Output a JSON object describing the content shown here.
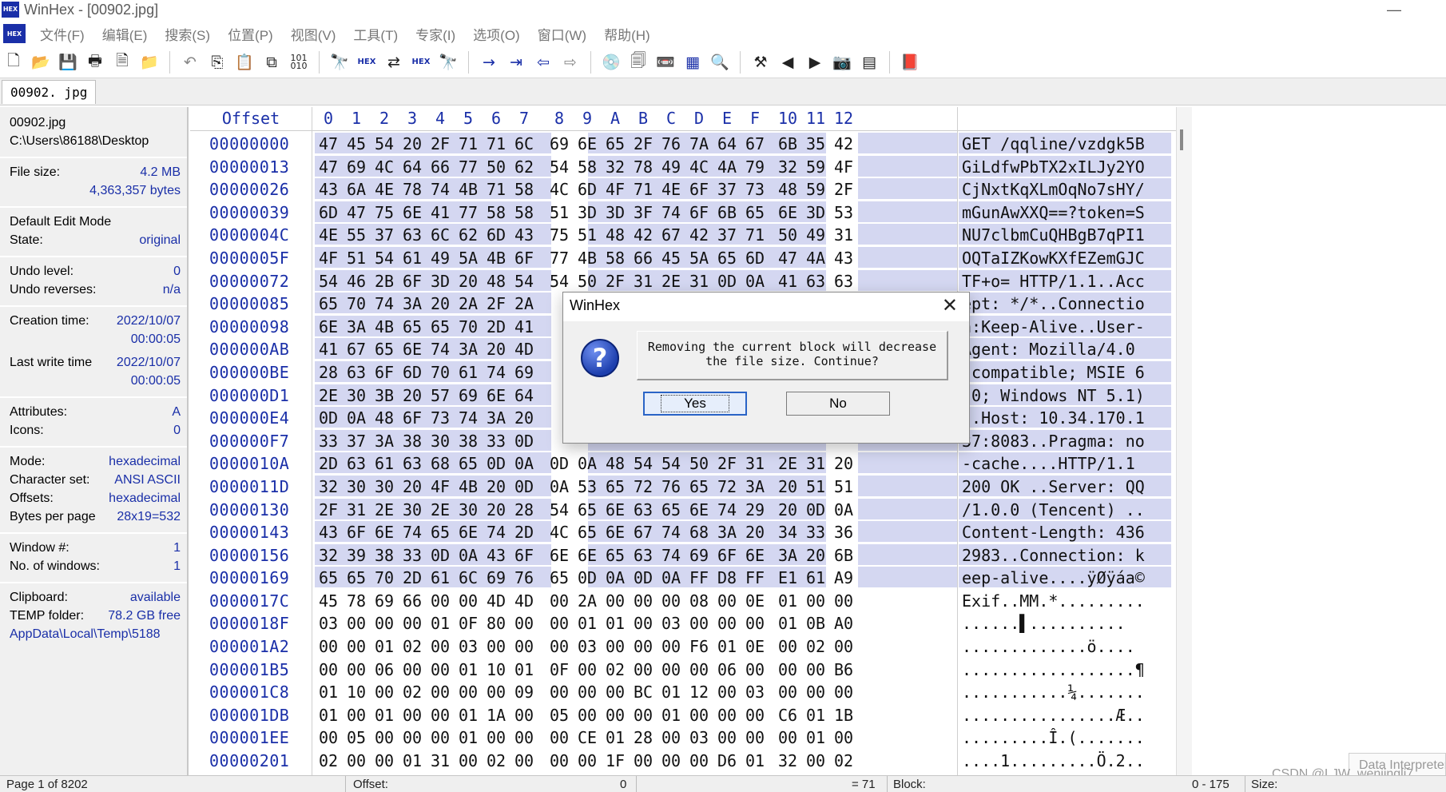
{
  "window": {
    "title": "WinHex - [00902.jpg]",
    "logo_text": "HEX",
    "minimize": "—"
  },
  "menu": [
    "文件(F)",
    "编辑(E)",
    "搜索(S)",
    "位置(P)",
    "视图(V)",
    "工具(T)",
    "专家(I)",
    "选项(O)",
    "窗口(W)",
    "帮助(H)"
  ],
  "toolbar": {
    "icons": [
      "new-file-icon",
      "open-folder-icon",
      "save-icon",
      "print-icon",
      "properties-icon",
      "open-folder-edit-icon",
      "undo-icon",
      "copy-icon",
      "paste-icon",
      "paste-special-icon",
      "binary-icon",
      "find-icon",
      "find-hex-icon",
      "replace-icon",
      "replace-hex-icon",
      "find-next-icon",
      "goto-offset-icon",
      "goto-sector-icon",
      "back-icon",
      "forward-icon",
      "disk-icon",
      "clone-icon",
      "tape-icon",
      "ram-icon",
      "search-icon",
      "tool-icon",
      "prev-icon",
      "next-icon",
      "camera-icon",
      "table-icon",
      "book-icon"
    ]
  },
  "tab": {
    "label": "00902. jpg"
  },
  "info": {
    "filename": "00902.jpg",
    "path": "C:\\Users\\86188\\Desktop",
    "file_size_label": "File size:",
    "file_size_mb": "4.2 MB",
    "file_size_bytes": "4,363,357 bytes",
    "edit_mode_label": "Default Edit Mode",
    "state_label": "State:",
    "state_value": "original",
    "undo_level_label": "Undo level:",
    "undo_level_value": "0",
    "undo_reverses_label": "Undo reverses:",
    "undo_reverses_value": "n/a",
    "creation_label": "Creation time:",
    "creation_date": "2022/10/07",
    "creation_time": "00:00:05",
    "lastwrite_label": "Last write time",
    "lastwrite_date": "2022/10/07",
    "lastwrite_time": "00:00:05",
    "attributes_label": "Attributes:",
    "attributes_value": "A",
    "icons_label": "Icons:",
    "icons_value": "0",
    "mode_label": "Mode:",
    "mode_value": "hexadecimal",
    "charset_label": "Character set:",
    "charset_value": "ANSI ASCII",
    "offsets_label": "Offsets:",
    "offsets_value": "hexadecimal",
    "bpp_label": "Bytes per page",
    "bpp_value": "28x19=532",
    "window_label": "Window #:",
    "window_value": "1",
    "nwindows_label": "No. of windows:",
    "nwindows_value": "1",
    "clipboard_label": "Clipboard:",
    "clipboard_value": "available",
    "temp_label": "TEMP folder:",
    "temp_value": "78.2 GB free",
    "temp_path": "5188\\AppData\\Local\\Temp"
  },
  "hex": {
    "offset_header": "Offset",
    "columns": [
      "0",
      "1",
      "2",
      "3",
      "4",
      "5",
      "6",
      "7",
      "8",
      "9",
      "A",
      "B",
      "C",
      "D",
      "E",
      "F",
      "10",
      "11",
      "12"
    ],
    "highlight_rows": 20,
    "rows": [
      {
        "offset": "00000000",
        "bytes": [
          "47",
          "45",
          "54",
          "20",
          "2F",
          "71",
          "71",
          "6C",
          "69",
          "6E",
          "65",
          "2F",
          "76",
          "7A",
          "64",
          "67",
          "6B",
          "35",
          "42"
        ],
        "ascii": "GET /qqline/vzdgk5B"
      },
      {
        "offset": "00000013",
        "bytes": [
          "47",
          "69",
          "4C",
          "64",
          "66",
          "77",
          "50",
          "62",
          "54",
          "58",
          "32",
          "78",
          "49",
          "4C",
          "4A",
          "79",
          "32",
          "59",
          "4F"
        ],
        "ascii": "GiLdfwPbTX2xILJy2YO"
      },
      {
        "offset": "00000026",
        "bytes": [
          "43",
          "6A",
          "4E",
          "78",
          "74",
          "4B",
          "71",
          "58",
          "4C",
          "6D",
          "4F",
          "71",
          "4E",
          "6F",
          "37",
          "73",
          "48",
          "59",
          "2F"
        ],
        "ascii": "CjNxtKqXLmOqNo7sHY/"
      },
      {
        "offset": "00000039",
        "bytes": [
          "6D",
          "47",
          "75",
          "6E",
          "41",
          "77",
          "58",
          "58",
          "51",
          "3D",
          "3D",
          "3F",
          "74",
          "6F",
          "6B",
          "65",
          "6E",
          "3D",
          "53"
        ],
        "ascii": "mGunAwXXQ==?token=S"
      },
      {
        "offset": "0000004C",
        "bytes": [
          "4E",
          "55",
          "37",
          "63",
          "6C",
          "62",
          "6D",
          "43",
          "75",
          "51",
          "48",
          "42",
          "67",
          "42",
          "37",
          "71",
          "50",
          "49",
          "31"
        ],
        "ascii": "NU7clbmCuQHBgB7qPI1"
      },
      {
        "offset": "0000005F",
        "bytes": [
          "4F",
          "51",
          "54",
          "61",
          "49",
          "5A",
          "4B",
          "6F",
          "77",
          "4B",
          "58",
          "66",
          "45",
          "5A",
          "65",
          "6D",
          "47",
          "4A",
          "43"
        ],
        "ascii": "OQTaIZKowKXfEZemGJC"
      },
      {
        "offset": "00000072",
        "bytes": [
          "54",
          "46",
          "2B",
          "6F",
          "3D",
          "20",
          "48",
          "54",
          "54",
          "50",
          "2F",
          "31",
          "2E",
          "31",
          "0D",
          "0A",
          "41",
          "63",
          "63"
        ],
        "ascii": "TF+o= HTTP/1.1..Acc"
      },
      {
        "offset": "00000085",
        "bytes": [
          "65",
          "70",
          "74",
          "3A",
          "20",
          "2A",
          "2F",
          "2A",
          "",
          "",
          "",
          "",
          "",
          "",
          "",
          "",
          "",
          "",
          ""
        ],
        "ascii": "ept: */*..Connectio"
      },
      {
        "offset": "00000098",
        "bytes": [
          "6E",
          "3A",
          "4B",
          "65",
          "65",
          "70",
          "2D",
          "41",
          "",
          "",
          "",
          "",
          "",
          "",
          "",
          "",
          "",
          "",
          ""
        ],
        "ascii": "n:Keep-Alive..User-"
      },
      {
        "offset": "000000AB",
        "bytes": [
          "41",
          "67",
          "65",
          "6E",
          "74",
          "3A",
          "20",
          "4D",
          "",
          "",
          "",
          "",
          "",
          "",
          "",
          "",
          "",
          "",
          ""
        ],
        "ascii": "Agent: Mozilla/4.0"
      },
      {
        "offset": "000000BE",
        "bytes": [
          "28",
          "63",
          "6F",
          "6D",
          "70",
          "61",
          "74",
          "69",
          "",
          "",
          "",
          "",
          "",
          "",
          "",
          "",
          "",
          "",
          ""
        ],
        "ascii": "(compatible; MSIE 6"
      },
      {
        "offset": "000000D1",
        "bytes": [
          "2E",
          "30",
          "3B",
          "20",
          "57",
          "69",
          "6E",
          "64",
          "",
          "",
          "",
          "",
          "",
          "",
          "",
          "",
          "",
          "",
          ""
        ],
        "ascii": ".0; Windows NT 5.1)"
      },
      {
        "offset": "000000E4",
        "bytes": [
          "0D",
          "0A",
          "48",
          "6F",
          "73",
          "74",
          "3A",
          "20",
          "",
          "",
          "",
          "",
          "",
          "",
          "",
          "",
          "",
          "",
          ""
        ],
        "ascii": "..Host: 10.34.170.1"
      },
      {
        "offset": "000000F7",
        "bytes": [
          "33",
          "37",
          "3A",
          "38",
          "30",
          "38",
          "33",
          "0D",
          "",
          "",
          "",
          "",
          "",
          "",
          "",
          "",
          "",
          "",
          ""
        ],
        "ascii": "37:8083..Pragma: no"
      },
      {
        "offset": "0000010A",
        "bytes": [
          "2D",
          "63",
          "61",
          "63",
          "68",
          "65",
          "0D",
          "0A",
          "0D",
          "0A",
          "48",
          "54",
          "54",
          "50",
          "2F",
          "31",
          "2E",
          "31",
          "20"
        ],
        "ascii": "-cache....HTTP/1.1 "
      },
      {
        "offset": "0000011D",
        "bytes": [
          "32",
          "30",
          "30",
          "20",
          "4F",
          "4B",
          "20",
          "0D",
          "0A",
          "53",
          "65",
          "72",
          "76",
          "65",
          "72",
          "3A",
          "20",
          "51",
          "51"
        ],
        "ascii": "200 OK ..Server: QQ"
      },
      {
        "offset": "00000130",
        "bytes": [
          "2F",
          "31",
          "2E",
          "30",
          "2E",
          "30",
          "20",
          "28",
          "54",
          "65",
          "6E",
          "63",
          "65",
          "6E",
          "74",
          "29",
          "20",
          "0D",
          "0A"
        ],
        "ascii": "/1.0.0 (Tencent) .."
      },
      {
        "offset": "00000143",
        "bytes": [
          "43",
          "6F",
          "6E",
          "74",
          "65",
          "6E",
          "74",
          "2D",
          "4C",
          "65",
          "6E",
          "67",
          "74",
          "68",
          "3A",
          "20",
          "34",
          "33",
          "36"
        ],
        "ascii": "Content-Length: 436"
      },
      {
        "offset": "00000156",
        "bytes": [
          "32",
          "39",
          "38",
          "33",
          "0D",
          "0A",
          "43",
          "6F",
          "6E",
          "6E",
          "65",
          "63",
          "74",
          "69",
          "6F",
          "6E",
          "3A",
          "20",
          "6B"
        ],
        "ascii": "2983..Connection: k"
      },
      {
        "offset": "00000169",
        "bytes": [
          "65",
          "65",
          "70",
          "2D",
          "61",
          "6C",
          "69",
          "76",
          "65",
          "0D",
          "0A",
          "0D",
          "0A",
          "FF",
          "D8",
          "FF",
          "E1",
          "61",
          "A9"
        ],
        "ascii": "eep-alive....ÿØÿáa©"
      },
      {
        "offset": "0000017C",
        "bytes": [
          "45",
          "78",
          "69",
          "66",
          "00",
          "00",
          "4D",
          "4D",
          "00",
          "2A",
          "00",
          "00",
          "00",
          "08",
          "00",
          "0E",
          "01",
          "00",
          "00"
        ],
        "ascii": "Exif..MM.*........."
      },
      {
        "offset": "0000018F",
        "bytes": [
          "03",
          "00",
          "00",
          "00",
          "01",
          "0F",
          "80",
          "00",
          "00",
          "01",
          "01",
          "00",
          "03",
          "00",
          "00",
          "00",
          "01",
          "0B",
          "A0"
        ],
        "ascii": "......▌.......... "
      },
      {
        "offset": "000001A2",
        "bytes": [
          "00",
          "00",
          "01",
          "02",
          "00",
          "03",
          "00",
          "00",
          "00",
          "03",
          "00",
          "00",
          "00",
          "F6",
          "01",
          "0E",
          "00",
          "02",
          "00"
        ],
        "ascii": ".............ö...."
      },
      {
        "offset": "000001B5",
        "bytes": [
          "00",
          "00",
          "06",
          "00",
          "00",
          "01",
          "10",
          "01",
          "0F",
          "00",
          "02",
          "00",
          "00",
          "00",
          "06",
          "00",
          "00",
          "00",
          "B6"
        ],
        "ascii": "..................¶"
      },
      {
        "offset": "000001C8",
        "bytes": [
          "01",
          "10",
          "00",
          "02",
          "00",
          "00",
          "00",
          "09",
          "00",
          "00",
          "00",
          "BC",
          "01",
          "12",
          "00",
          "03",
          "00",
          "00",
          "00"
        ],
        "ascii": "...........¼......."
      },
      {
        "offset": "000001DB",
        "bytes": [
          "01",
          "00",
          "01",
          "00",
          "00",
          "01",
          "1A",
          "00",
          "05",
          "00",
          "00",
          "00",
          "01",
          "00",
          "00",
          "00",
          "C6",
          "01",
          "1B"
        ],
        "ascii": "................Æ.."
      },
      {
        "offset": "000001EE",
        "bytes": [
          "00",
          "05",
          "00",
          "00",
          "00",
          "01",
          "00",
          "00",
          "00",
          "CE",
          "01",
          "28",
          "00",
          "03",
          "00",
          "00",
          "00",
          "01",
          "00"
        ],
        "ascii": ".........Î.(......."
      },
      {
        "offset": "00000201",
        "bytes": [
          "02",
          "00",
          "00",
          "01",
          "31",
          "00",
          "02",
          "00",
          "00",
          "00",
          "1F",
          "00",
          "00",
          "00",
          "D6",
          "01",
          "32",
          "00",
          "02"
        ],
        "ascii": "....1.........Ö.2.."
      }
    ]
  },
  "dialog": {
    "title": "WinHex",
    "close": "✕",
    "icon": "?",
    "message_line1": "Removing the current block will decrease",
    "message_line2": "the file size. Continue?",
    "yes": "Yes",
    "no": "No"
  },
  "status": {
    "page": "Page 1 of 8202",
    "offset_label": "Offset:",
    "offset_value": "0",
    "eq_value": "= 71",
    "block_label": "Block:",
    "block_range": "0 - 175",
    "size_label": "Size:"
  },
  "side": {
    "data_interpreter": "Data Interpreter",
    "watermark": "CSDN @LJW_wenjingli7"
  }
}
